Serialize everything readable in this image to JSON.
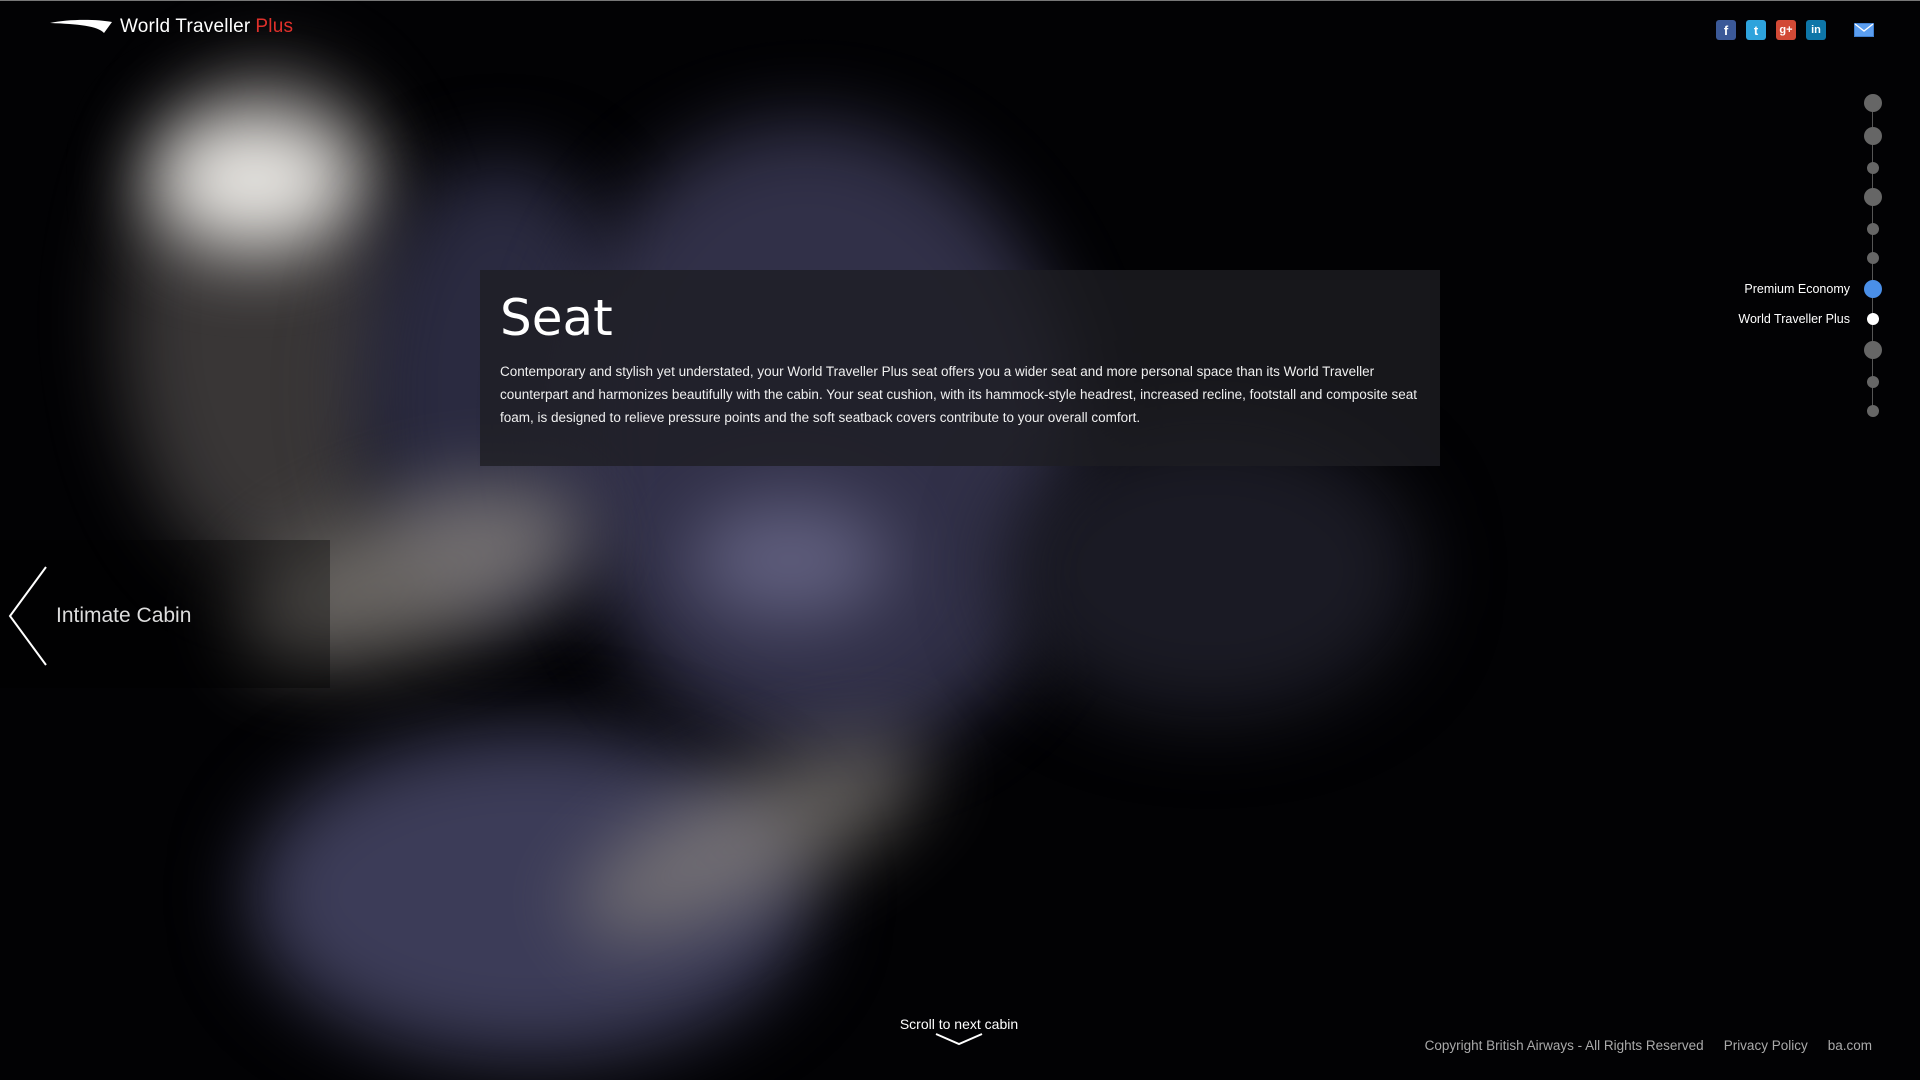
{
  "header": {
    "brand_name": "World Traveller",
    "brand_suffix": "Plus",
    "brand_suffix_color": "#e0302b",
    "logo_icon": "speedmarque-icon",
    "social": [
      {
        "name": "facebook-icon",
        "glyph": "f",
        "color": "#3b5998"
      },
      {
        "name": "twitter-icon",
        "glyph": "t",
        "color": "#2ea3dc"
      },
      {
        "name": "google-plus-icon",
        "glyph": "g+",
        "color": "#d24a36"
      },
      {
        "name": "linkedin-icon",
        "glyph": "in",
        "color": "#0e76a8"
      },
      {
        "name": "email-icon",
        "glyph": "✉",
        "color": "#4a8fe8"
      }
    ]
  },
  "panel": {
    "title": "Seat",
    "body": "Contemporary and stylish yet understated, your World Traveller Plus seat offers you a wider seat and more personal space than its World Traveller counterpart and harmonizes beautifully with the cabin. Your seat cushion, with its hammock-style headrest, increased recline, footstall and composite seat foam, is designed to relieve pressure points and the soft seatback covers contribute to your overall comfort."
  },
  "nav": {
    "prev_label": "Intimate Cabin",
    "prev_icon": "chevron-left-icon"
  },
  "timeline": {
    "active_color": "#4a8fe8",
    "labels": {
      "active": "Premium Economy",
      "current": "World Traveller Plus"
    }
  },
  "scroll": {
    "label": "Scroll to next cabin",
    "icon": "chevron-down-icon"
  },
  "footer": {
    "copyright": "Copyright British Airways - All Rights Reserved",
    "privacy": "Privacy Policy",
    "site": "ba.com"
  }
}
